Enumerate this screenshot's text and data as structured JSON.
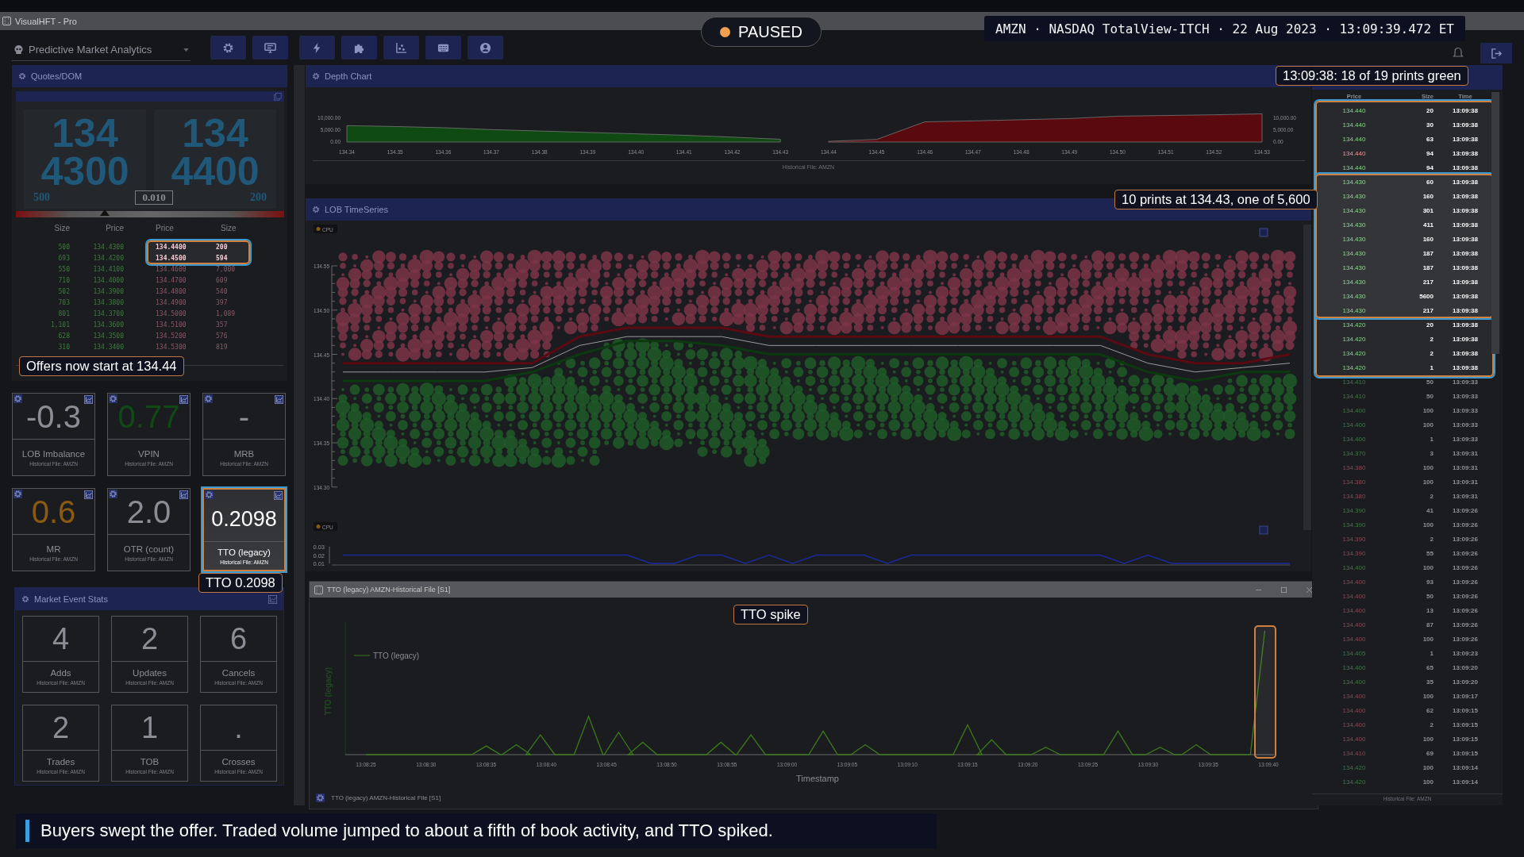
{
  "window": {
    "title": "VisualHFT - Pro"
  },
  "toolbar": {
    "workspace": "Predictive Market Analytics",
    "buttons": [
      {
        "kind": "settings"
      },
      {
        "kind": "monitor"
      },
      {
        "kind": "bolt"
      },
      {
        "kind": "plugin"
      },
      {
        "kind": "scatter"
      },
      {
        "kind": "keyboard"
      },
      {
        "kind": "user"
      }
    ]
  },
  "playback": {
    "status": "PAUSED",
    "paused": true
  },
  "session_info": "AMZN · NASDAQ TotalView-ITCH · 22 Aug 2023 · 13:09:39.472 ET",
  "quotes_dom": {
    "title": "Quotes/DOM",
    "bid": {
      "price_major": "134",
      "price_minor": "4300",
      "size": "500"
    },
    "ask": {
      "price_major": "134",
      "price_minor": "4400",
      "size": "200"
    },
    "spread": "0.010",
    "balance_bar": {
      "level": 0.33
    },
    "columns": [
      "Size",
      "Price",
      "Price",
      "Size"
    ],
    "rows": [
      {
        "bid_size": "500",
        "bid_price": "134.4300",
        "ask_price": "134.4400",
        "ask_size": "200",
        "highlighted": true
      },
      {
        "bid_size": "693",
        "bid_price": "134.4200",
        "ask_price": "134.4500",
        "ask_size": "594",
        "highlighted": true
      },
      {
        "bid_size": "550",
        "bid_price": "134.4100",
        "ask_price": "134.4600",
        "ask_size": "7,000",
        "highlighted": false
      },
      {
        "bid_size": "710",
        "bid_price": "134.4000",
        "ask_price": "134.4700",
        "ask_size": "609",
        "highlighted": false
      },
      {
        "bid_size": "502",
        "bid_price": "134.3900",
        "ask_price": "134.4800",
        "ask_size": "540",
        "highlighted": false
      },
      {
        "bid_size": "703",
        "bid_price": "134.3800",
        "ask_price": "134.4900",
        "ask_size": "397",
        "highlighted": false
      },
      {
        "bid_size": "801",
        "bid_price": "134.3700",
        "ask_price": "134.5000",
        "ask_size": "1,089",
        "highlighted": false
      },
      {
        "bid_size": "1,101",
        "bid_price": "134.3600",
        "ask_price": "134.5100",
        "ask_size": "357",
        "highlighted": false
      },
      {
        "bid_size": "628",
        "bid_price": "134.3500",
        "ask_price": "134.5200",
        "ask_size": "576",
        "highlighted": false
      },
      {
        "bid_size": "310",
        "bid_price": "134.3400",
        "ask_price": "134.5300",
        "ask_size": "819",
        "highlighted": false
      }
    ],
    "callout": "Offers now start at 134.44"
  },
  "metrics": {
    "tiles": [
      {
        "value": "-0.3",
        "label": "LOB Imbalance",
        "source": "Historical File: AMZN",
        "color": "#8a8d93",
        "highlighted": false
      },
      {
        "value": "0.77",
        "label": "VPIN",
        "source": "Historical File: AMZN",
        "color": "#0f4a14",
        "highlighted": false
      },
      {
        "value": "-",
        "label": "MRB",
        "source": "Historical File: AMZN",
        "color": "#8a8d93",
        "highlighted": false
      },
      {
        "value": "0.6",
        "label": "MR",
        "source": "Historical File: AMZN",
        "color": "#8a5a10",
        "highlighted": false
      },
      {
        "value": "2.0",
        "label": "OTR (count)",
        "source": "Historical File: AMZN",
        "color": "#8a8d93",
        "highlighted": false
      },
      {
        "value": "0.2098",
        "label": "TTO (legacy)",
        "source": "Historical File: AMZN",
        "color": "#ffffff",
        "highlighted": true
      }
    ],
    "callout": "TTO 0.2098"
  },
  "market_event_stats": {
    "title": "Market Event Stats",
    "tiles": [
      {
        "value": "4",
        "label": "Adds",
        "source": "Historical File: AMZN"
      },
      {
        "value": "2",
        "label": "Updates",
        "source": "Historical File: AMZN"
      },
      {
        "value": "6",
        "label": "Cancels",
        "source": "Historical File: AMZN"
      },
      {
        "value": "2",
        "label": "Trades",
        "source": "Historical File: AMZN"
      },
      {
        "value": "1",
        "label": "TOB",
        "source": "Historical File: AMZN"
      },
      {
        "value": ".",
        "label": "Crosses",
        "source": "Historical File: AMZN"
      }
    ]
  },
  "depth_chart": {
    "title": "Depth Chart",
    "footer": "Historical File: AMZN",
    "right_axis_ticks": [
      "10,000.00",
      "5,000.00",
      "0.00"
    ],
    "chart_data": {
      "type": "area",
      "x": [
        134.34,
        134.35,
        134.36,
        134.37,
        134.38,
        134.39,
        134.4,
        134.41,
        134.42,
        134.43,
        134.44,
        134.45,
        134.46,
        134.47,
        134.48,
        134.49,
        134.5,
        134.51,
        134.52,
        134.53
      ],
      "series": [
        {
          "color": "#0e4a12",
          "values": [
            7000,
            6600,
            6100,
            5300,
            4700,
            4100,
            3500,
            2900,
            2100,
            1200,
            null,
            null,
            null,
            null,
            null,
            null,
            null,
            null,
            null,
            null
          ]
        },
        {
          "color": "#5a0a0e",
          "values": [
            null,
            null,
            null,
            null,
            null,
            null,
            null,
            null,
            null,
            null,
            300,
            1100,
            8600,
            9000,
            9500,
            10000,
            11000,
            11300,
            11600,
            12000
          ]
        }
      ],
      "xlim": [
        134.34,
        134.53
      ],
      "ylim": [
        0,
        12500
      ],
      "yticks": [
        {
          "value": 0,
          "label": "0.00"
        },
        {
          "value": 5000,
          "label": "5,000.00"
        },
        {
          "value": 10000,
          "label": "10,000.00"
        }
      ],
      "xticks": [
        {
          "value": 134.34,
          "label": "134.34"
        },
        {
          "value": 134.35,
          "label": "134.35"
        },
        {
          "value": 134.36,
          "label": "134.36"
        },
        {
          "value": 134.37,
          "label": "134.37"
        },
        {
          "value": 134.38,
          "label": "134.38"
        },
        {
          "value": 134.39,
          "label": "134.39"
        },
        {
          "value": 134.4,
          "label": "134.40"
        },
        {
          "value": 134.41,
          "label": "134.41"
        },
        {
          "value": 134.42,
          "label": "134.42"
        },
        {
          "value": 134.43,
          "label": "134.43"
        },
        {
          "value": 134.44,
          "label": "134.44"
        },
        {
          "value": 134.45,
          "label": "134.45"
        },
        {
          "value": 134.46,
          "label": "134.46"
        },
        {
          "value": 134.47,
          "label": "134.47"
        },
        {
          "value": 134.48,
          "label": "134.48"
        },
        {
          "value": 134.49,
          "label": "134.49"
        },
        {
          "value": 134.5,
          "label": "134.50"
        },
        {
          "value": 134.51,
          "label": "134.51"
        },
        {
          "value": 134.52,
          "label": "134.52"
        },
        {
          "value": 134.53,
          "label": "134.53"
        }
      ]
    }
  },
  "lob_timeseries": {
    "title": "LOB TimeSeries",
    "legend": "CPU",
    "chart_data": {
      "type": "line",
      "categories": [
        null,
        null,
        null,
        null,
        null,
        null,
        null,
        null,
        null,
        null,
        null,
        null,
        null,
        null,
        null,
        null,
        null,
        null,
        null,
        null,
        null
      ],
      "series": [
        {
          "color": "#5a0a10",
          "values": [
            134.44,
            134.44,
            134.44,
            134.44,
            134.44,
            134.47,
            134.48,
            134.48,
            134.48,
            134.47,
            134.47,
            134.47,
            134.47,
            134.47,
            134.47,
            134.47,
            134.47,
            134.45,
            134.44,
            134.44,
            134.45
          ]
        },
        {
          "color": "#9a9a9a",
          "values": [
            134.43,
            134.43,
            134.43,
            134.43,
            134.435,
            134.46,
            134.47,
            134.47,
            134.47,
            134.46,
            134.46,
            134.46,
            134.46,
            134.46,
            134.46,
            134.46,
            134.46,
            134.44,
            134.43,
            134.435,
            134.44
          ]
        },
        {
          "color": "#0c3a10",
          "values": [
            134.42,
            134.42,
            134.42,
            134.42,
            134.43,
            134.45,
            134.465,
            134.465,
            134.46,
            134.45,
            134.45,
            134.45,
            134.45,
            134.45,
            134.45,
            134.45,
            134.45,
            134.43,
            134.42,
            134.43,
            134.43
          ]
        }
      ],
      "ylim": [
        134.3,
        134.55
      ],
      "yticks": [
        {
          "value": 134.55,
          "label": "134.55"
        },
        {
          "value": 134.5,
          "label": "134.50"
        },
        {
          "value": 134.45,
          "label": "134.45"
        },
        {
          "value": 134.4,
          "label": "134.40"
        },
        {
          "value": 134.35,
          "label": "134.35"
        },
        {
          "value": 134.3,
          "label": "134.30"
        }
      ]
    },
    "cpu_chart": {
      "legend": "CPU",
      "chart_data": {
        "type": "line",
        "categories": [
          null,
          null,
          null,
          null,
          null,
          null,
          null,
          null,
          null,
          null,
          null,
          null,
          null,
          null,
          null,
          null,
          null,
          null,
          null,
          null,
          null,
          null,
          null,
          null,
          null,
          null,
          null,
          null,
          null,
          null,
          null,
          null,
          null,
          null,
          null,
          null,
          null,
          null,
          null,
          null,
          null
        ],
        "series": [
          {
            "color": "#1a2a9a",
            "values": [
              0.02,
              0.02,
              0.02,
              0.02,
              0.02,
              0.02,
              0.02,
              0.02,
              0.02,
              0.02,
              0.02,
              0.02,
              0.02,
              0.01,
              0.01,
              0.02,
              0.02,
              0.01,
              0.02,
              0.01,
              0.02,
              0.02,
              0.02,
              0.01,
              0.02,
              0.02,
              0.02,
              0.02,
              0.02,
              0.02,
              0.02,
              0.02,
              0.02,
              0.01,
              0.02,
              0.01,
              0.01,
              0.01,
              0.01,
              0.01,
              0.01
            ]
          }
        ],
        "ylim": [
          0.01,
          0.03
        ],
        "yticks": [
          {
            "value": 0.03,
            "label": "0.03"
          },
          {
            "value": 0.02,
            "label": "0.02"
          },
          {
            "value": 0.01,
            "label": "0.01"
          }
        ]
      }
    },
    "callout": "10 prints at 134.43, one of 5,600"
  },
  "tto_window": {
    "title": "TTO (legacy) AMZN-Historical File [S1]",
    "legend": "TTO (legacy)",
    "ylabel": "TTO (legacy)",
    "xlabel": "Timestamp",
    "x_ticks": [
      "13:08:25",
      "13:08:30",
      "13:08:35",
      "13:08:40",
      "13:08:45",
      "13:08:50",
      "13:08:55",
      "13:09:00",
      "13:09:05",
      "13:09:10",
      "13:09:15",
      "13:09:20",
      "13:09:25",
      "13:09:30",
      "13:09:35",
      "13:09:40"
    ],
    "spike_highlighted": true,
    "callout": "TTO spike",
    "footer": "TTO (legacy) AMZN-Historical File [S1]"
  },
  "trades": {
    "columns": [
      "Price",
      "Size",
      "Time"
    ],
    "callout": "13:09:38: 18 of 19 prints green",
    "footer": "Historical File: AMZN",
    "rows": [
      {
        "price": "134.440",
        "size": "20",
        "time": "13:09:38",
        "sell": false,
        "recent": true,
        "in_frame": true,
        "in_focus": false
      },
      {
        "price": "134.440",
        "size": "30",
        "time": "13:09:38",
        "sell": false,
        "recent": true,
        "in_frame": true,
        "in_focus": false
      },
      {
        "price": "134.440",
        "size": "63",
        "time": "13:09:38",
        "sell": false,
        "recent": true,
        "in_frame": true,
        "in_focus": false
      },
      {
        "price": "134.440",
        "size": "94",
        "time": "13:09:38",
        "sell": true,
        "recent": true,
        "in_frame": true,
        "in_focus": false
      },
      {
        "price": "134.440",
        "size": "94",
        "time": "13:09:38",
        "sell": false,
        "recent": true,
        "in_frame": true,
        "in_focus": false
      },
      {
        "price": "134.430",
        "size": "60",
        "time": "13:09:38",
        "sell": false,
        "recent": true,
        "in_frame": true,
        "in_focus": true
      },
      {
        "price": "134.430",
        "size": "160",
        "time": "13:09:38",
        "sell": false,
        "recent": true,
        "in_frame": true,
        "in_focus": true
      },
      {
        "price": "134.430",
        "size": "301",
        "time": "13:09:38",
        "sell": false,
        "recent": true,
        "in_frame": true,
        "in_focus": true
      },
      {
        "price": "134.430",
        "size": "411",
        "time": "13:09:38",
        "sell": false,
        "recent": true,
        "in_frame": true,
        "in_focus": true
      },
      {
        "price": "134.430",
        "size": "160",
        "time": "13:09:38",
        "sell": false,
        "recent": true,
        "in_frame": true,
        "in_focus": true
      },
      {
        "price": "134.430",
        "size": "187",
        "time": "13:09:38",
        "sell": false,
        "recent": true,
        "in_frame": true,
        "in_focus": true
      },
      {
        "price": "134.430",
        "size": "187",
        "time": "13:09:38",
        "sell": false,
        "recent": true,
        "in_frame": true,
        "in_focus": true
      },
      {
        "price": "134.430",
        "size": "217",
        "time": "13:09:38",
        "sell": false,
        "recent": true,
        "in_frame": true,
        "in_focus": true
      },
      {
        "price": "134.430",
        "size": "5600",
        "time": "13:09:38",
        "sell": false,
        "recent": true,
        "in_frame": true,
        "in_focus": true
      },
      {
        "price": "134.430",
        "size": "217",
        "time": "13:09:38",
        "sell": false,
        "recent": true,
        "in_frame": true,
        "in_focus": true
      },
      {
        "price": "134.420",
        "size": "20",
        "time": "13:09:38",
        "sell": false,
        "recent": true,
        "in_frame": true,
        "in_focus": false
      },
      {
        "price": "134.420",
        "size": "2",
        "time": "13:09:38",
        "sell": false,
        "recent": true,
        "in_frame": true,
        "in_focus": false
      },
      {
        "price": "134.420",
        "size": "2",
        "time": "13:09:38",
        "sell": false,
        "recent": true,
        "in_frame": true,
        "in_focus": false
      },
      {
        "price": "134.420",
        "size": "1",
        "time": "13:09:38",
        "sell": false,
        "recent": true,
        "in_frame": true,
        "in_focus": false
      },
      {
        "price": "134.410",
        "size": "50",
        "time": "13:09:33",
        "sell": false,
        "recent": false,
        "in_frame": false,
        "in_focus": false
      },
      {
        "price": "134.410",
        "size": "50",
        "time": "13:09:33",
        "sell": false,
        "recent": false,
        "in_frame": false,
        "in_focus": false
      },
      {
        "price": "134.400",
        "size": "100",
        "time": "13:09:33",
        "sell": false,
        "recent": false,
        "in_frame": false,
        "in_focus": false
      },
      {
        "price": "134.400",
        "size": "100",
        "time": "13:09:33",
        "sell": false,
        "recent": false,
        "in_frame": false,
        "in_focus": false
      },
      {
        "price": "134.400",
        "size": "1",
        "time": "13:09:33",
        "sell": false,
        "recent": false,
        "in_frame": false,
        "in_focus": false
      },
      {
        "price": "134.370",
        "size": "3",
        "time": "13:09:31",
        "sell": false,
        "recent": false,
        "in_frame": false,
        "in_focus": false
      },
      {
        "price": "134.380",
        "size": "100",
        "time": "13:09:31",
        "sell": true,
        "recent": false,
        "in_frame": false,
        "in_focus": false
      },
      {
        "price": "134.380",
        "size": "100",
        "time": "13:09:31",
        "sell": true,
        "recent": false,
        "in_frame": false,
        "in_focus": false
      },
      {
        "price": "134.380",
        "size": "2",
        "time": "13:09:31",
        "sell": true,
        "recent": false,
        "in_frame": false,
        "in_focus": false
      },
      {
        "price": "134.390",
        "size": "41",
        "time": "13:09:26",
        "sell": false,
        "recent": false,
        "in_frame": false,
        "in_focus": false
      },
      {
        "price": "134.390",
        "size": "100",
        "time": "13:09:26",
        "sell": false,
        "recent": false,
        "in_frame": false,
        "in_focus": false
      },
      {
        "price": "134.390",
        "size": "2",
        "time": "13:09:26",
        "sell": true,
        "recent": false,
        "in_frame": false,
        "in_focus": false
      },
      {
        "price": "134.390",
        "size": "55",
        "time": "13:09:26",
        "sell": true,
        "recent": false,
        "in_frame": false,
        "in_focus": false
      },
      {
        "price": "134.400",
        "size": "100",
        "time": "13:09:26",
        "sell": false,
        "recent": false,
        "in_frame": false,
        "in_focus": false
      },
      {
        "price": "134.400",
        "size": "93",
        "time": "13:09:26",
        "sell": true,
        "recent": false,
        "in_frame": false,
        "in_focus": false
      },
      {
        "price": "134.400",
        "size": "50",
        "time": "13:09:26",
        "sell": true,
        "recent": false,
        "in_frame": false,
        "in_focus": false
      },
      {
        "price": "134.400",
        "size": "13",
        "time": "13:09:26",
        "sell": true,
        "recent": false,
        "in_frame": false,
        "in_focus": false
      },
      {
        "price": "134.400",
        "size": "87",
        "time": "13:09:26",
        "sell": true,
        "recent": false,
        "in_frame": false,
        "in_focus": false
      },
      {
        "price": "134.400",
        "size": "100",
        "time": "13:09:26",
        "sell": true,
        "recent": false,
        "in_frame": false,
        "in_focus": false
      },
      {
        "price": "134.405",
        "size": "1",
        "time": "13:09:23",
        "sell": false,
        "recent": false,
        "in_frame": false,
        "in_focus": false
      },
      {
        "price": "134.400",
        "size": "65",
        "time": "13:09:20",
        "sell": false,
        "recent": false,
        "in_frame": false,
        "in_focus": false
      },
      {
        "price": "134.400",
        "size": "35",
        "time": "13:09:20",
        "sell": false,
        "recent": false,
        "in_frame": false,
        "in_focus": false
      },
      {
        "price": "134.400",
        "size": "100",
        "time": "13:09:17",
        "sell": true,
        "recent": false,
        "in_frame": false,
        "in_focus": false
      },
      {
        "price": "134.400",
        "size": "62",
        "time": "13:09:15",
        "sell": true,
        "recent": false,
        "in_frame": false,
        "in_focus": false
      },
      {
        "price": "134.400",
        "size": "2",
        "time": "13:09:15",
        "sell": true,
        "recent": false,
        "in_frame": false,
        "in_focus": false
      },
      {
        "price": "134.400",
        "size": "100",
        "time": "13:09:15",
        "sell": true,
        "recent": false,
        "in_frame": false,
        "in_focus": false
      },
      {
        "price": "134.410",
        "size": "69",
        "time": "13:09:15",
        "sell": true,
        "recent": false,
        "in_frame": false,
        "in_focus": false
      },
      {
        "price": "134.420",
        "size": "100",
        "time": "13:09:14",
        "sell": false,
        "recent": false,
        "in_frame": false,
        "in_focus": false
      },
      {
        "price": "134.420",
        "size": "100",
        "time": "13:09:14",
        "sell": false,
        "recent": false,
        "in_frame": false,
        "in_focus": false
      }
    ]
  },
  "caption": "Buyers swept the offer. Traded volume jumped to about a fifth of book activity, and TTO spiked."
}
